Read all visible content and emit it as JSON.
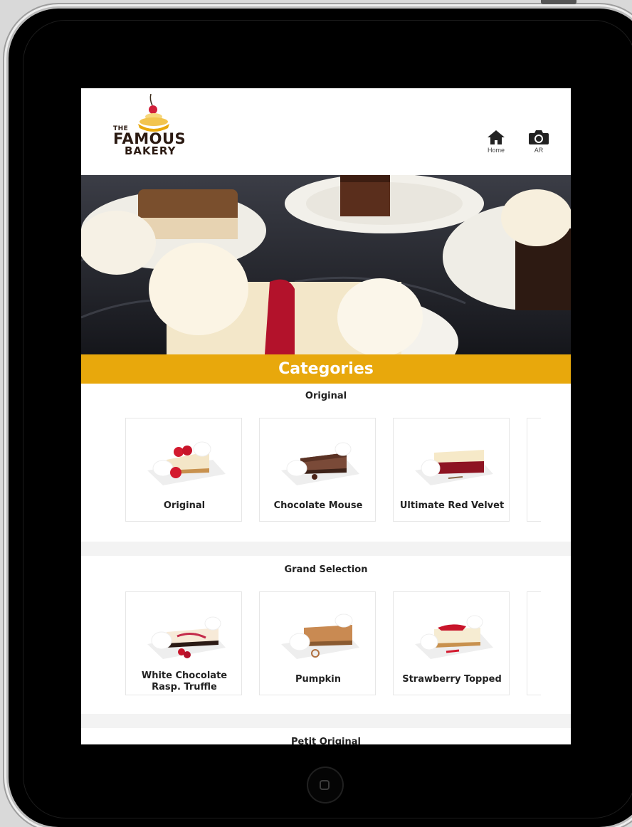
{
  "header": {
    "logo": {
      "line1": "THE",
      "line2": "FAMOUS",
      "line3": "BAKERY"
    },
    "nav": [
      {
        "label": "Home",
        "icon": "home-icon"
      },
      {
        "label": "AR",
        "icon": "camera-icon"
      }
    ]
  },
  "categories_title": "Categories",
  "sections": [
    {
      "title": "Original",
      "items": [
        {
          "label": "Original"
        },
        {
          "label": "Chocolate Mouse"
        },
        {
          "label": "Ultimate Red Velvet"
        }
      ]
    },
    {
      "title": "Grand Selection",
      "items": [
        {
          "label": "White Chocolate Rasp. Truffle"
        },
        {
          "label": "Pumpkin"
        },
        {
          "label": "Strawberry Topped"
        }
      ]
    },
    {
      "title": "Petit Original"
    }
  ],
  "colors": {
    "accent": "#e8a80c",
    "arrow": "#e8a80c"
  }
}
